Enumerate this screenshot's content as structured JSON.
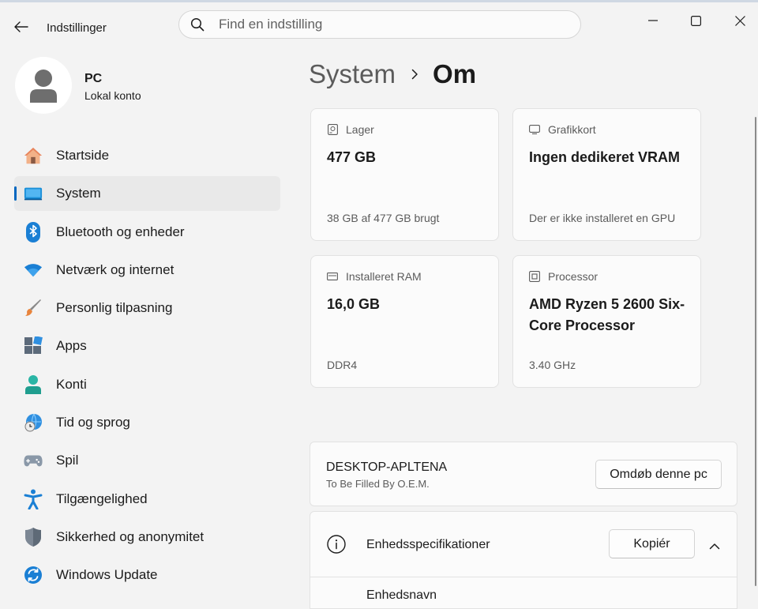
{
  "window": {
    "app_title": "Indstillinger",
    "search_placeholder": "Find en indstilling"
  },
  "profile": {
    "name": "PC",
    "account_type": "Lokal konto"
  },
  "sidebar": {
    "items": [
      {
        "label": "Startside",
        "icon": "home-icon"
      },
      {
        "label": "System",
        "icon": "system-icon",
        "active": true
      },
      {
        "label": "Bluetooth og enheder",
        "icon": "bluetooth-icon"
      },
      {
        "label": "Netværk og internet",
        "icon": "wifi-icon"
      },
      {
        "label": "Personlig tilpasning",
        "icon": "brush-icon"
      },
      {
        "label": "Apps",
        "icon": "apps-icon"
      },
      {
        "label": "Konti",
        "icon": "account-icon"
      },
      {
        "label": "Tid og sprog",
        "icon": "globe-clock-icon"
      },
      {
        "label": "Spil",
        "icon": "gamepad-icon"
      },
      {
        "label": "Tilgængelighed",
        "icon": "accessibility-icon"
      },
      {
        "label": "Sikkerhed og anonymitet",
        "icon": "shield-icon"
      },
      {
        "label": "Windows Update",
        "icon": "update-icon"
      }
    ]
  },
  "breadcrumb": {
    "parent": "System",
    "current": "Om"
  },
  "cards": [
    {
      "label": "Lager",
      "value": "477 GB",
      "footer": "38 GB af 477 GB brugt",
      "icon": "storage-icon"
    },
    {
      "label": "Grafikkort",
      "value": "Ingen dedikeret VRAM",
      "footer": "Der er ikke installeret en GPU",
      "icon": "gpu-icon"
    },
    {
      "label": "Installeret RAM",
      "value": "16,0 GB",
      "footer": "DDR4",
      "icon": "ram-icon"
    },
    {
      "label": "Processor",
      "value": "AMD Ryzen 5 2600 Six-Core Processor",
      "footer": "3.40 GHz",
      "icon": "cpu-icon"
    }
  ],
  "device": {
    "name": "DESKTOP-APLTENA",
    "model": "To Be Filled By O.E.M.",
    "rename_label": "Omdøb denne pc"
  },
  "specs": {
    "title": "Enhedsspecifikationer",
    "copy_label": "Kopiér",
    "first_row_label": "Enhedsnavn"
  },
  "colors": {
    "accent": "#0067c0",
    "background": "#f3f3f3",
    "card": "#fbfbfb"
  }
}
